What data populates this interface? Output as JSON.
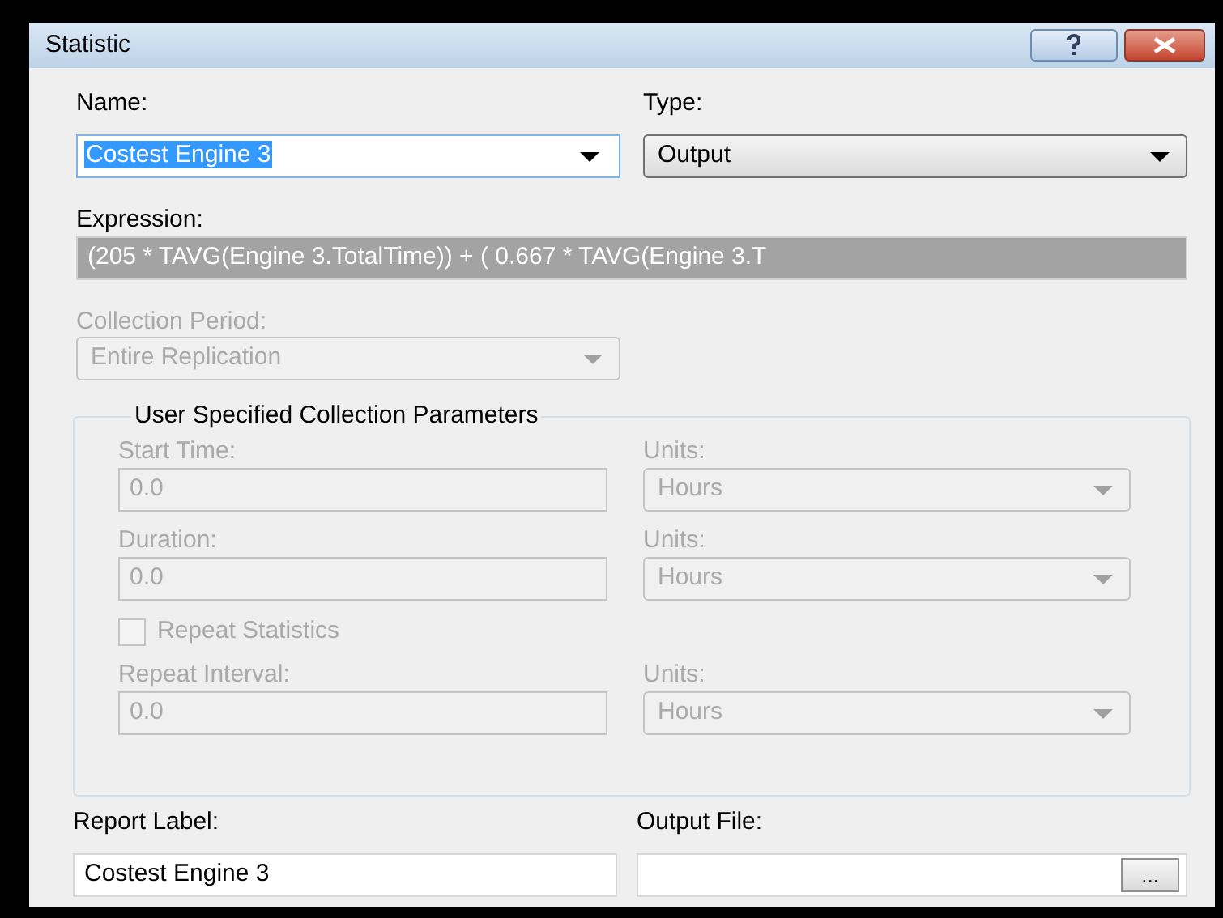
{
  "window": {
    "title": "Statistic"
  },
  "name": {
    "label": "Name:",
    "value": "Costest Engine 3",
    "selected": true
  },
  "type": {
    "label": "Type:",
    "value": "Output"
  },
  "expression": {
    "label": "Expression:",
    "value": "(205 * TAVG(Engine 3.TotalTime)) + ( 0.667 * TAVG(Engine 3.T",
    "disabled": true
  },
  "collection_period": {
    "label": "Collection Period:",
    "value": "Entire Replication",
    "disabled": true
  },
  "group": {
    "title": "User Specified Collection Parameters",
    "rows": [
      {
        "kind": "fields",
        "label": "Start Time:",
        "value": "0.0",
        "units_label": "Units:",
        "units": "Hours",
        "disabled": true
      },
      {
        "kind": "fields",
        "label": "Duration:",
        "value": "0.0",
        "units_label": "Units:",
        "units": "Hours",
        "disabled": true
      },
      {
        "kind": "checkbox",
        "label": "Repeat Statistics",
        "checked": false,
        "disabled": true
      },
      {
        "kind": "fields",
        "label": "Repeat Interval:",
        "value": "0.0",
        "units_label": "Units:",
        "units": "Hours",
        "disabled": true
      }
    ]
  },
  "report_label": {
    "label": "Report Label:",
    "value": "Costest Engine 3"
  },
  "output_file": {
    "label": "Output File:",
    "button": "..."
  }
}
